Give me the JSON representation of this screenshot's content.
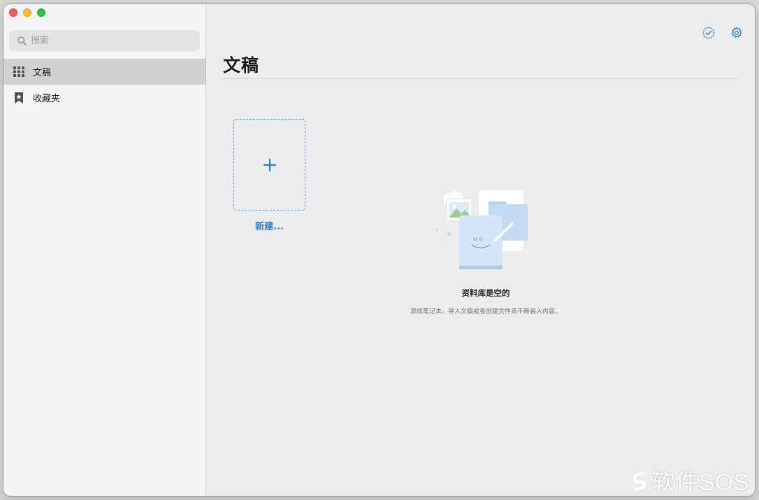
{
  "window": {
    "traffic_lights": [
      "close",
      "minimize",
      "zoom"
    ]
  },
  "sidebar": {
    "search": {
      "placeholder": "搜索",
      "value": ""
    },
    "items": [
      {
        "label": "文稿",
        "icon": "grid-icon",
        "active": true
      },
      {
        "label": "收藏夹",
        "icon": "bookmark-star-icon",
        "active": false
      }
    ]
  },
  "main": {
    "title": "文稿",
    "toolbar": {
      "select_icon": "checkmark-circle-icon",
      "settings_icon": "gear-icon"
    },
    "new_tile": {
      "label": "新建..."
    },
    "empty_state": {
      "title": "资料库是空的",
      "description": "添加笔记本，导入文稿或者创建文件夹不断装入内容。"
    }
  },
  "watermark": {
    "text": "软件SOS"
  },
  "colors": {
    "accent": "#2c7ed8",
    "sidebar_bg": "#f5f5f5",
    "main_bg": "#ececec",
    "selected_row": "#d1d1d1"
  }
}
